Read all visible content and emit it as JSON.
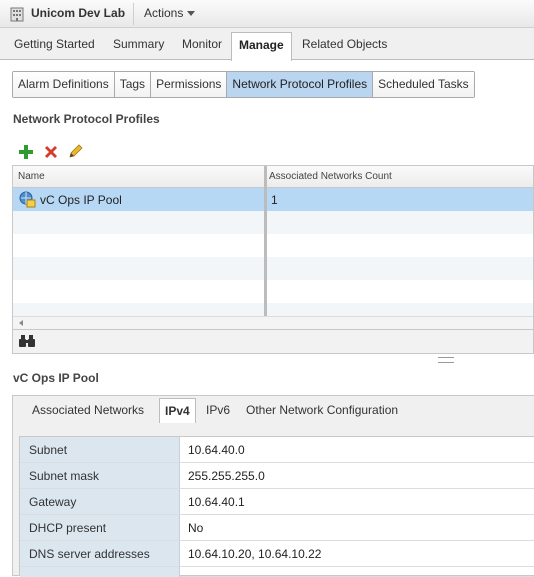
{
  "header": {
    "title": "Unicom Dev Lab",
    "actions_label": "Actions"
  },
  "main_tabs": [
    "Getting Started",
    "Summary",
    "Monitor",
    "Manage",
    "Related Objects"
  ],
  "sub_tabs": [
    "Alarm Definitions",
    "Tags",
    "Permissions",
    "Network Protocol Profiles",
    "Scheduled Tasks"
  ],
  "section": {
    "title": "Network Protocol Profiles"
  },
  "toolbar": {
    "add_icon": "plus-icon",
    "delete_icon": "x-icon",
    "edit_icon": "pencil-icon"
  },
  "grid": {
    "columns": [
      "Name",
      "Associated Networks Count"
    ],
    "rows": [
      {
        "name": "vC Ops IP Pool",
        "count": "1"
      }
    ]
  },
  "detail": {
    "title": "vC Ops IP Pool",
    "tabs": [
      "Associated Networks",
      "IPv4",
      "IPv6",
      "Other Network Configuration"
    ],
    "properties": [
      {
        "label": "Subnet",
        "value": "10.64.40.0"
      },
      {
        "label": "Subnet mask",
        "value": "255.255.255.0"
      },
      {
        "label": "Gateway",
        "value": "10.64.40.1"
      },
      {
        "label": "DHCP present",
        "value": "No"
      },
      {
        "label": "DNS server addresses",
        "value": "10.64.10.20, 10.64.10.22"
      }
    ]
  },
  "colors": {
    "selected_row": "#b7d8f5",
    "active_subtab": "#b9d5f0",
    "label_bg": "#dbe6ef"
  }
}
